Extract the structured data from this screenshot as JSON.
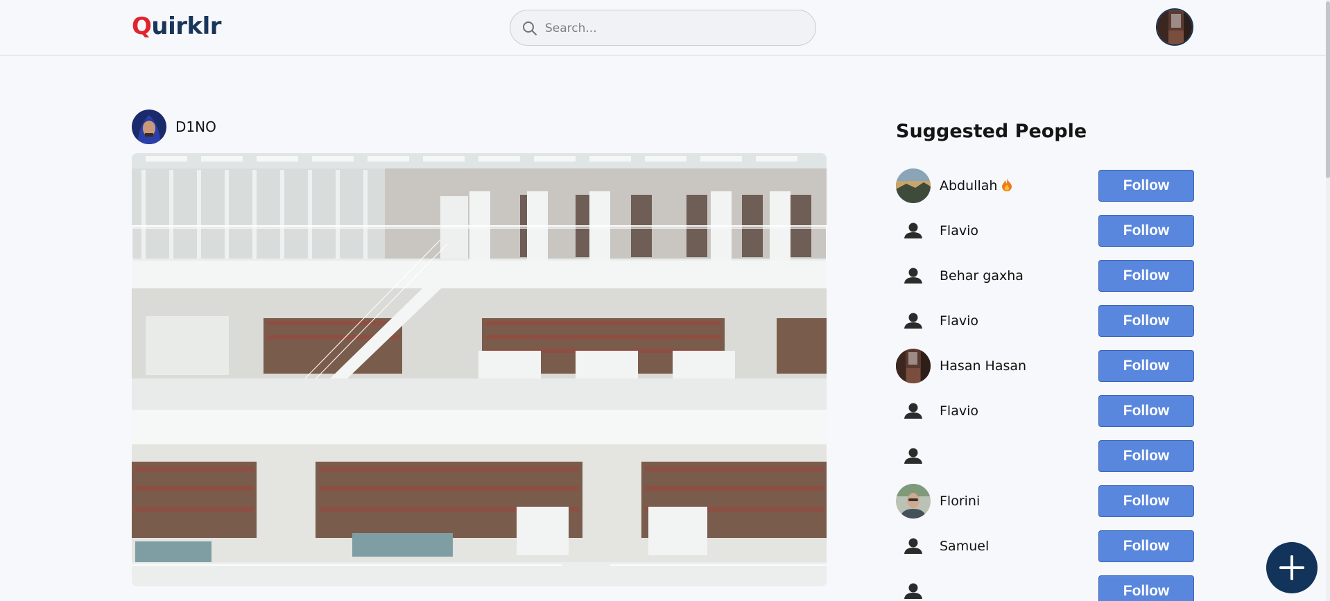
{
  "header": {
    "logo_first": "Q",
    "logo_rest": "uirklr",
    "search_placeholder": "Search..."
  },
  "post": {
    "author": "D1NO"
  },
  "suggested": {
    "title": "Suggested People",
    "follow_label": "Follow",
    "people": [
      {
        "name": "Abdullah",
        "avatar": "photo-landscape",
        "badge": "fire-emoji"
      },
      {
        "name": "Flavio",
        "avatar": "default-user-icon"
      },
      {
        "name": "Behar gaxha",
        "avatar": "default-user-icon"
      },
      {
        "name": "Flavio",
        "avatar": "default-user-icon"
      },
      {
        "name": "Hasan Hasan",
        "avatar": "photo-street"
      },
      {
        "name": "Flavio",
        "avatar": "default-user-icon"
      },
      {
        "name": "",
        "avatar": "default-user-icon"
      },
      {
        "name": "Florini",
        "avatar": "photo-man"
      },
      {
        "name": "Samuel",
        "avatar": "default-user-icon"
      },
      {
        "name": "",
        "avatar": "default-user-icon"
      }
    ]
  },
  "colors": {
    "brand_navy": "#19365a",
    "brand_red": "#e0242c",
    "follow_blue": "#5a87de",
    "fab_navy": "#12345a"
  }
}
